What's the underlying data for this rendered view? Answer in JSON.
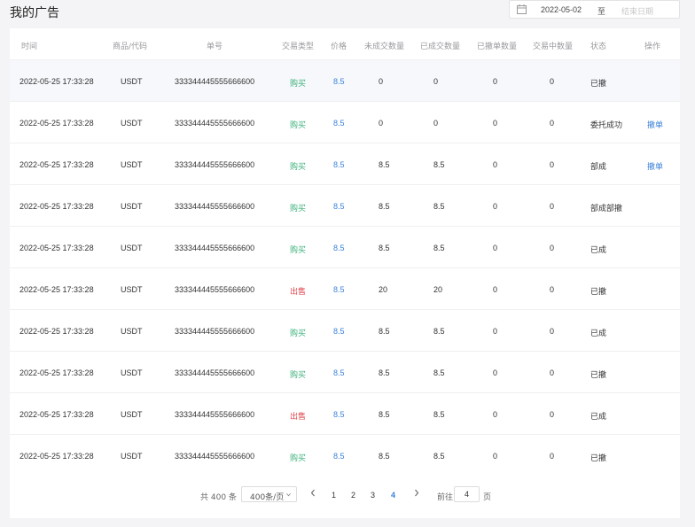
{
  "header": {
    "title": "我的广告",
    "date_start": "2022-05-02",
    "date_to": "至",
    "date_end_placeholder": "结束日期"
  },
  "table": {
    "columns": [
      "时间",
      "商品/代码",
      "单号",
      "交易类型",
      "价格",
      "未成交数量",
      "已成交数量",
      "已撤单数量",
      "交易中数量",
      "状态",
      "操作"
    ],
    "rows": [
      {
        "time": "2022-05-25 17:33:28",
        "code": "USDT",
        "order": "333344445555666600",
        "type": "购买",
        "side": "buy",
        "price": "8.5",
        "unfilled": "0",
        "filled": "0",
        "cancelled": "0",
        "trading": "0",
        "status": "已撤",
        "action": ""
      },
      {
        "time": "2022-05-25 17:33:28",
        "code": "USDT",
        "order": "333344445555666600",
        "type": "购买",
        "side": "buy",
        "price": "8.5",
        "unfilled": "0",
        "filled": "0",
        "cancelled": "0",
        "trading": "0",
        "status": "委托成功",
        "action": "撤单"
      },
      {
        "time": "2022-05-25 17:33:28",
        "code": "USDT",
        "order": "333344445555666600",
        "type": "购买",
        "side": "buy",
        "price": "8.5",
        "unfilled": "8.5",
        "filled": "8.5",
        "cancelled": "0",
        "trading": "0",
        "status": "部成",
        "action": "撤单"
      },
      {
        "time": "2022-05-25 17:33:28",
        "code": "USDT",
        "order": "333344445555666600",
        "type": "购买",
        "side": "buy",
        "price": "8.5",
        "unfilled": "8.5",
        "filled": "8.5",
        "cancelled": "0",
        "trading": "0",
        "status": "部成部撤",
        "action": ""
      },
      {
        "time": "2022-05-25 17:33:28",
        "code": "USDT",
        "order": "333344445555666600",
        "type": "购买",
        "side": "buy",
        "price": "8.5",
        "unfilled": "8.5",
        "filled": "8.5",
        "cancelled": "0",
        "trading": "0",
        "status": "已成",
        "action": ""
      },
      {
        "time": "2022-05-25 17:33:28",
        "code": "USDT",
        "order": "333344445555666600",
        "type": "出售",
        "side": "sell",
        "price": "8.5",
        "unfilled": "20",
        "filled": "20",
        "cancelled": "0",
        "trading": "0",
        "status": "已撤",
        "action": ""
      },
      {
        "time": "2022-05-25 17:33:28",
        "code": "USDT",
        "order": "333344445555666600",
        "type": "购买",
        "side": "buy",
        "price": "8.5",
        "unfilled": "8.5",
        "filled": "8.5",
        "cancelled": "0",
        "trading": "0",
        "status": "已成",
        "action": ""
      },
      {
        "time": "2022-05-25 17:33:28",
        "code": "USDT",
        "order": "333344445555666600",
        "type": "购买",
        "side": "buy",
        "price": "8.5",
        "unfilled": "8.5",
        "filled": "8.5",
        "cancelled": "0",
        "trading": "0",
        "status": "已撤",
        "action": ""
      },
      {
        "time": "2022-05-25 17:33:28",
        "code": "USDT",
        "order": "333344445555666600",
        "type": "出售",
        "side": "sell",
        "price": "8.5",
        "unfilled": "8.5",
        "filled": "8.5",
        "cancelled": "0",
        "trading": "0",
        "status": "已成",
        "action": ""
      },
      {
        "time": "2022-05-25 17:33:28",
        "code": "USDT",
        "order": "333344445555666600",
        "type": "购买",
        "side": "buy",
        "price": "8.5",
        "unfilled": "8.5",
        "filled": "8.5",
        "cancelled": "0",
        "trading": "0",
        "status": "已撤",
        "action": ""
      }
    ]
  },
  "pagination": {
    "total_label": "共 400 条",
    "page_size": "400条/页",
    "pages": [
      "1",
      "2",
      "3",
      "4"
    ],
    "current": "4",
    "goto_label": "前往",
    "goto_value": "4",
    "page_label": "页"
  },
  "colors": {
    "buy": "#3bb07a",
    "sell": "#e0454b",
    "accent": "#3b82d8"
  },
  "icons": {
    "calendar": "calendar-icon",
    "prev": "chevron-left-icon",
    "next": "chevron-right-icon",
    "dropdown": "chevron-down-icon"
  }
}
